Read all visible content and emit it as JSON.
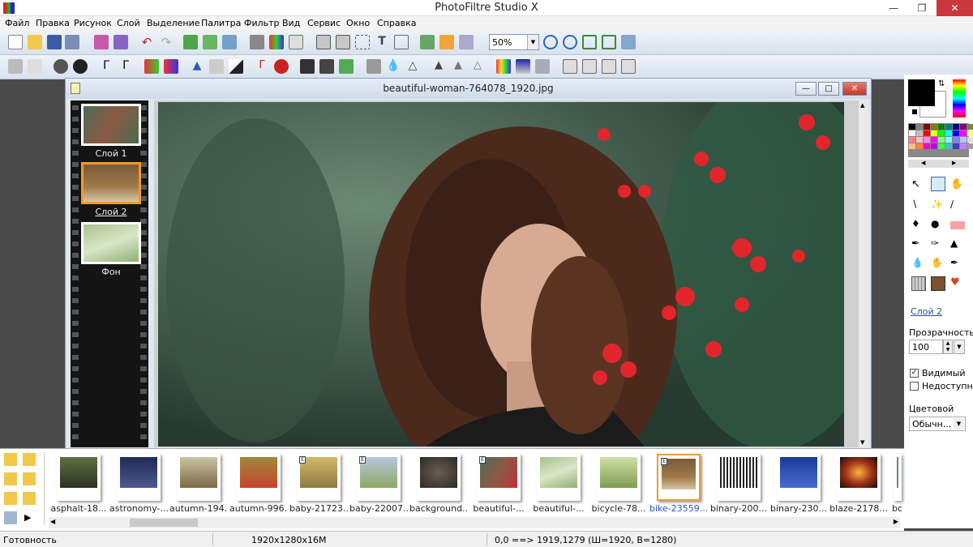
{
  "window": {
    "title": "PhotoFiltre Studio X"
  },
  "menu": [
    "Файл",
    "Правка",
    "Рисунок",
    "Слой",
    "Выделение",
    "Палитра",
    "Фильтр",
    "Вид",
    "Сервис",
    "Окно",
    "Справка"
  ],
  "toolbar": {
    "zoom_value": "50%"
  },
  "document": {
    "title": "beautiful-woman-764078_1920.jpg"
  },
  "layers": [
    {
      "label": "Слой 1",
      "selected": false
    },
    {
      "label": "Слой 2",
      "selected": true
    },
    {
      "label": "Фон",
      "selected": false
    }
  ],
  "colors": {
    "foreground": "#000000",
    "background": "#ffffff",
    "accent": "#f39b22"
  },
  "layer_panel": {
    "layer_name": "Слой 2",
    "opacity_label": "Прозрачность",
    "opacity_value": "100",
    "visible_label": "Видимый",
    "visible_checked": true,
    "locked_label": "Недоступн",
    "locked_checked": false,
    "colormode_label": "Цветовой режи",
    "colormode_value": "Обычн..."
  },
  "browser": {
    "thumbnails": [
      {
        "label": "asphalt-18...",
        "edited": false,
        "selected": false
      },
      {
        "label": "astronomy-...",
        "edited": false,
        "selected": false
      },
      {
        "label": "autumn-194...",
        "edited": false,
        "selected": false
      },
      {
        "label": "autumn-996...",
        "edited": false,
        "selected": false
      },
      {
        "label": "baby-21723...",
        "edited": true,
        "selected": false
      },
      {
        "label": "baby-22007...",
        "edited": true,
        "selected": false
      },
      {
        "label": "background...",
        "edited": false,
        "selected": false
      },
      {
        "label": "beautiful-...",
        "edited": true,
        "selected": false
      },
      {
        "label": "beautiful-...",
        "edited": false,
        "selected": false
      },
      {
        "label": "bicycle-78...",
        "edited": false,
        "selected": false
      },
      {
        "label": "bike-23559...",
        "edited": true,
        "selected": true
      },
      {
        "label": "binary-200...",
        "edited": false,
        "selected": false
      },
      {
        "label": "binary-230...",
        "edited": false,
        "selected": false
      },
      {
        "label": "blaze-2178...",
        "edited": false,
        "selected": false
      },
      {
        "label": "bo",
        "edited": false,
        "selected": false
      }
    ]
  },
  "status": {
    "ready": "Готовность",
    "image_info": "1920x1280x16M",
    "coords": "0,0 ==> 1919,1279 (Ш=1920, В=1280)"
  }
}
